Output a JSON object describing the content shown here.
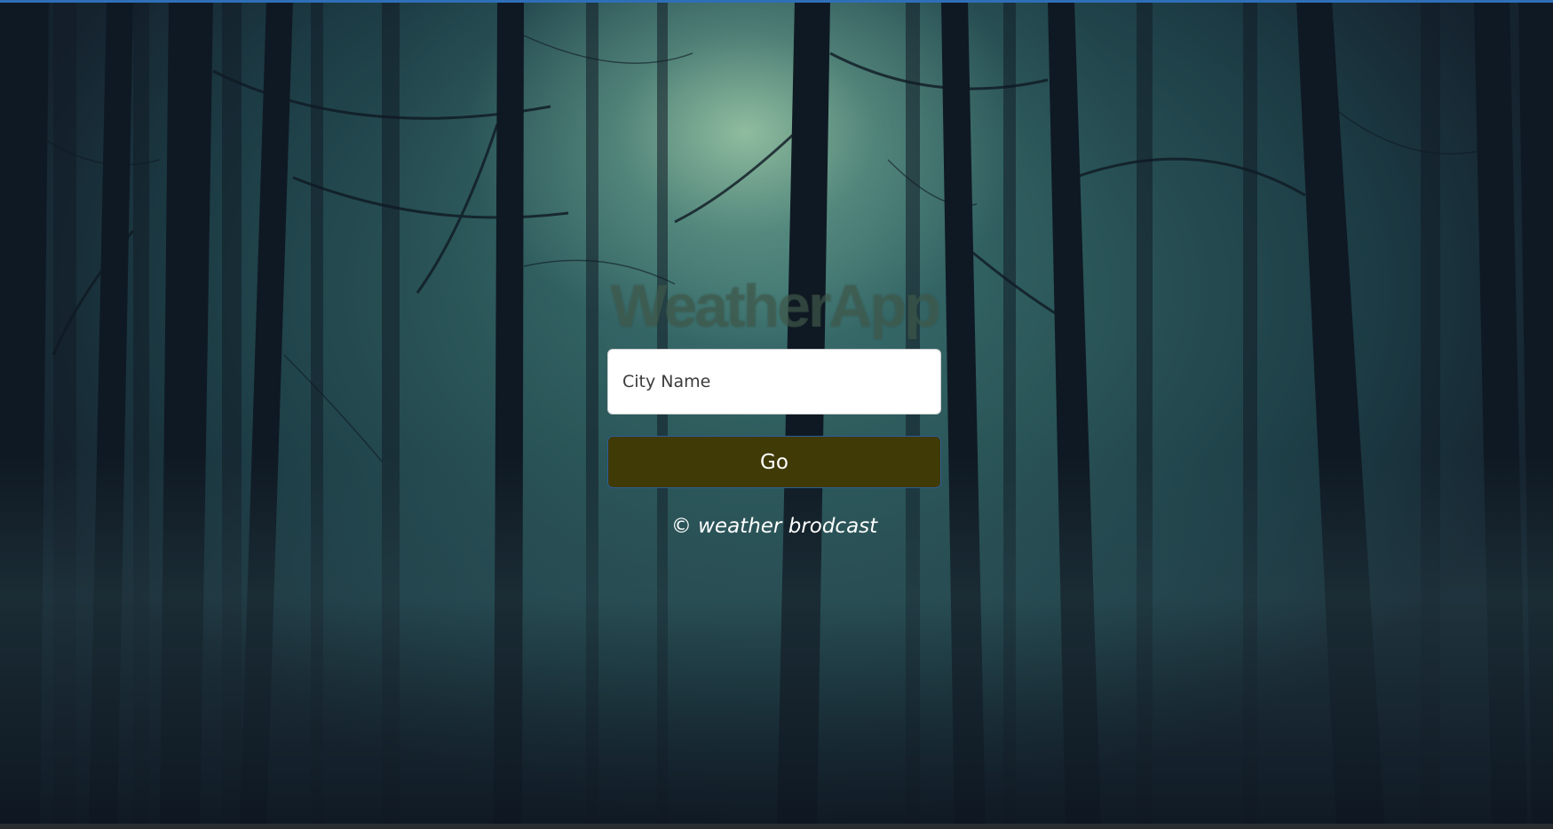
{
  "app": {
    "title": "WeatherApp"
  },
  "search": {
    "placeholder": "City Name",
    "value": ""
  },
  "actions": {
    "go_label": "Go"
  },
  "footer": {
    "text": "© weather brodcast"
  },
  "colors": {
    "go_button_bg": "#403a07",
    "go_button_border": "#2c5d99",
    "title_color": "#465f50",
    "top_bar": "#2f6fb8"
  }
}
